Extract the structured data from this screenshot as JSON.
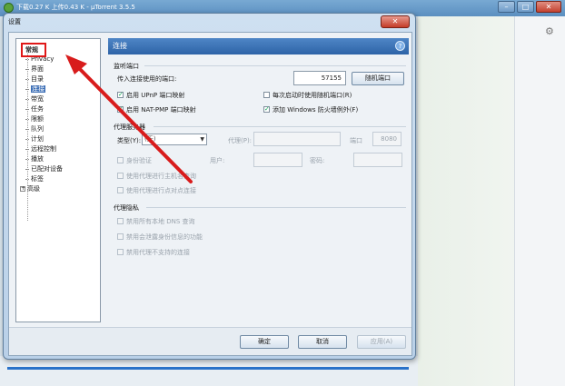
{
  "background_window": {
    "title": "下载0.27 K 上传0.43 K - µTorrent 3.5.5",
    "window_buttons": [
      "–",
      "□",
      "✕"
    ]
  },
  "dialog": {
    "title": "设置",
    "close_glyph": "✕",
    "tree": {
      "items": [
        {
          "label": "常规",
          "selected": false,
          "highlighted": true
        },
        {
          "label": "Privacy"
        },
        {
          "label": "界面"
        },
        {
          "label": "目录"
        },
        {
          "label": "连接",
          "selected": true
        },
        {
          "label": "带宽"
        },
        {
          "label": "任务"
        },
        {
          "label": "限额"
        },
        {
          "label": "队列"
        },
        {
          "label": "计划"
        },
        {
          "label": "远程控制"
        },
        {
          "label": "播放"
        },
        {
          "label": "已配对设备"
        },
        {
          "label": "标签"
        },
        {
          "label": "高级",
          "expander": "+"
        }
      ]
    },
    "panel": {
      "header": "连接",
      "help_glyph": "?",
      "listen_port": {
        "section": "监听端口",
        "port_label": "传入连接使用的端口:",
        "port_value": "57155",
        "random_button": "随机端口",
        "upnp": {
          "label": "启用 UPnP 端口映射",
          "checked": true
        },
        "random_on_start": {
          "label": "每次启动时使用随机端口(R)",
          "checked": false
        },
        "natpmp": {
          "label": "启用 NAT-PMP 端口映射",
          "checked": true
        },
        "firewall": {
          "label": "添加 Windows 防火墙例外(F)",
          "checked": true
        }
      },
      "proxy": {
        "section": "代理服务器",
        "type_label": "类型(Y):",
        "type_value": "(无)",
        "proxy_label": "代理(P):",
        "port_label": "端口",
        "port_value": "8080",
        "auth": {
          "label": "身份验证",
          "checked": false
        },
        "user_label": "用户:",
        "password_label": "密码:",
        "hostname_lookup": {
          "label": "使用代理进行主机名查询",
          "checked": false
        },
        "p2p_connections": {
          "label": "使用代理进行点对点连接",
          "checked": false
        }
      },
      "privacy": {
        "section": "代理隐私",
        "disable_dns": {
          "label": "禁用所有本地 DNS 查询",
          "checked": false
        },
        "disable_identifying": {
          "label": "禁用会泄露身份信息的功能",
          "checked": false
        },
        "disable_unsupported": {
          "label": "禁用代理不支持的连接",
          "checked": false
        }
      }
    },
    "footer": {
      "ok": "确定",
      "cancel": "取消",
      "apply": "应用(A)"
    }
  },
  "annotation": {
    "arrow_color": "#d81c1c",
    "box_color": "#e01818"
  }
}
